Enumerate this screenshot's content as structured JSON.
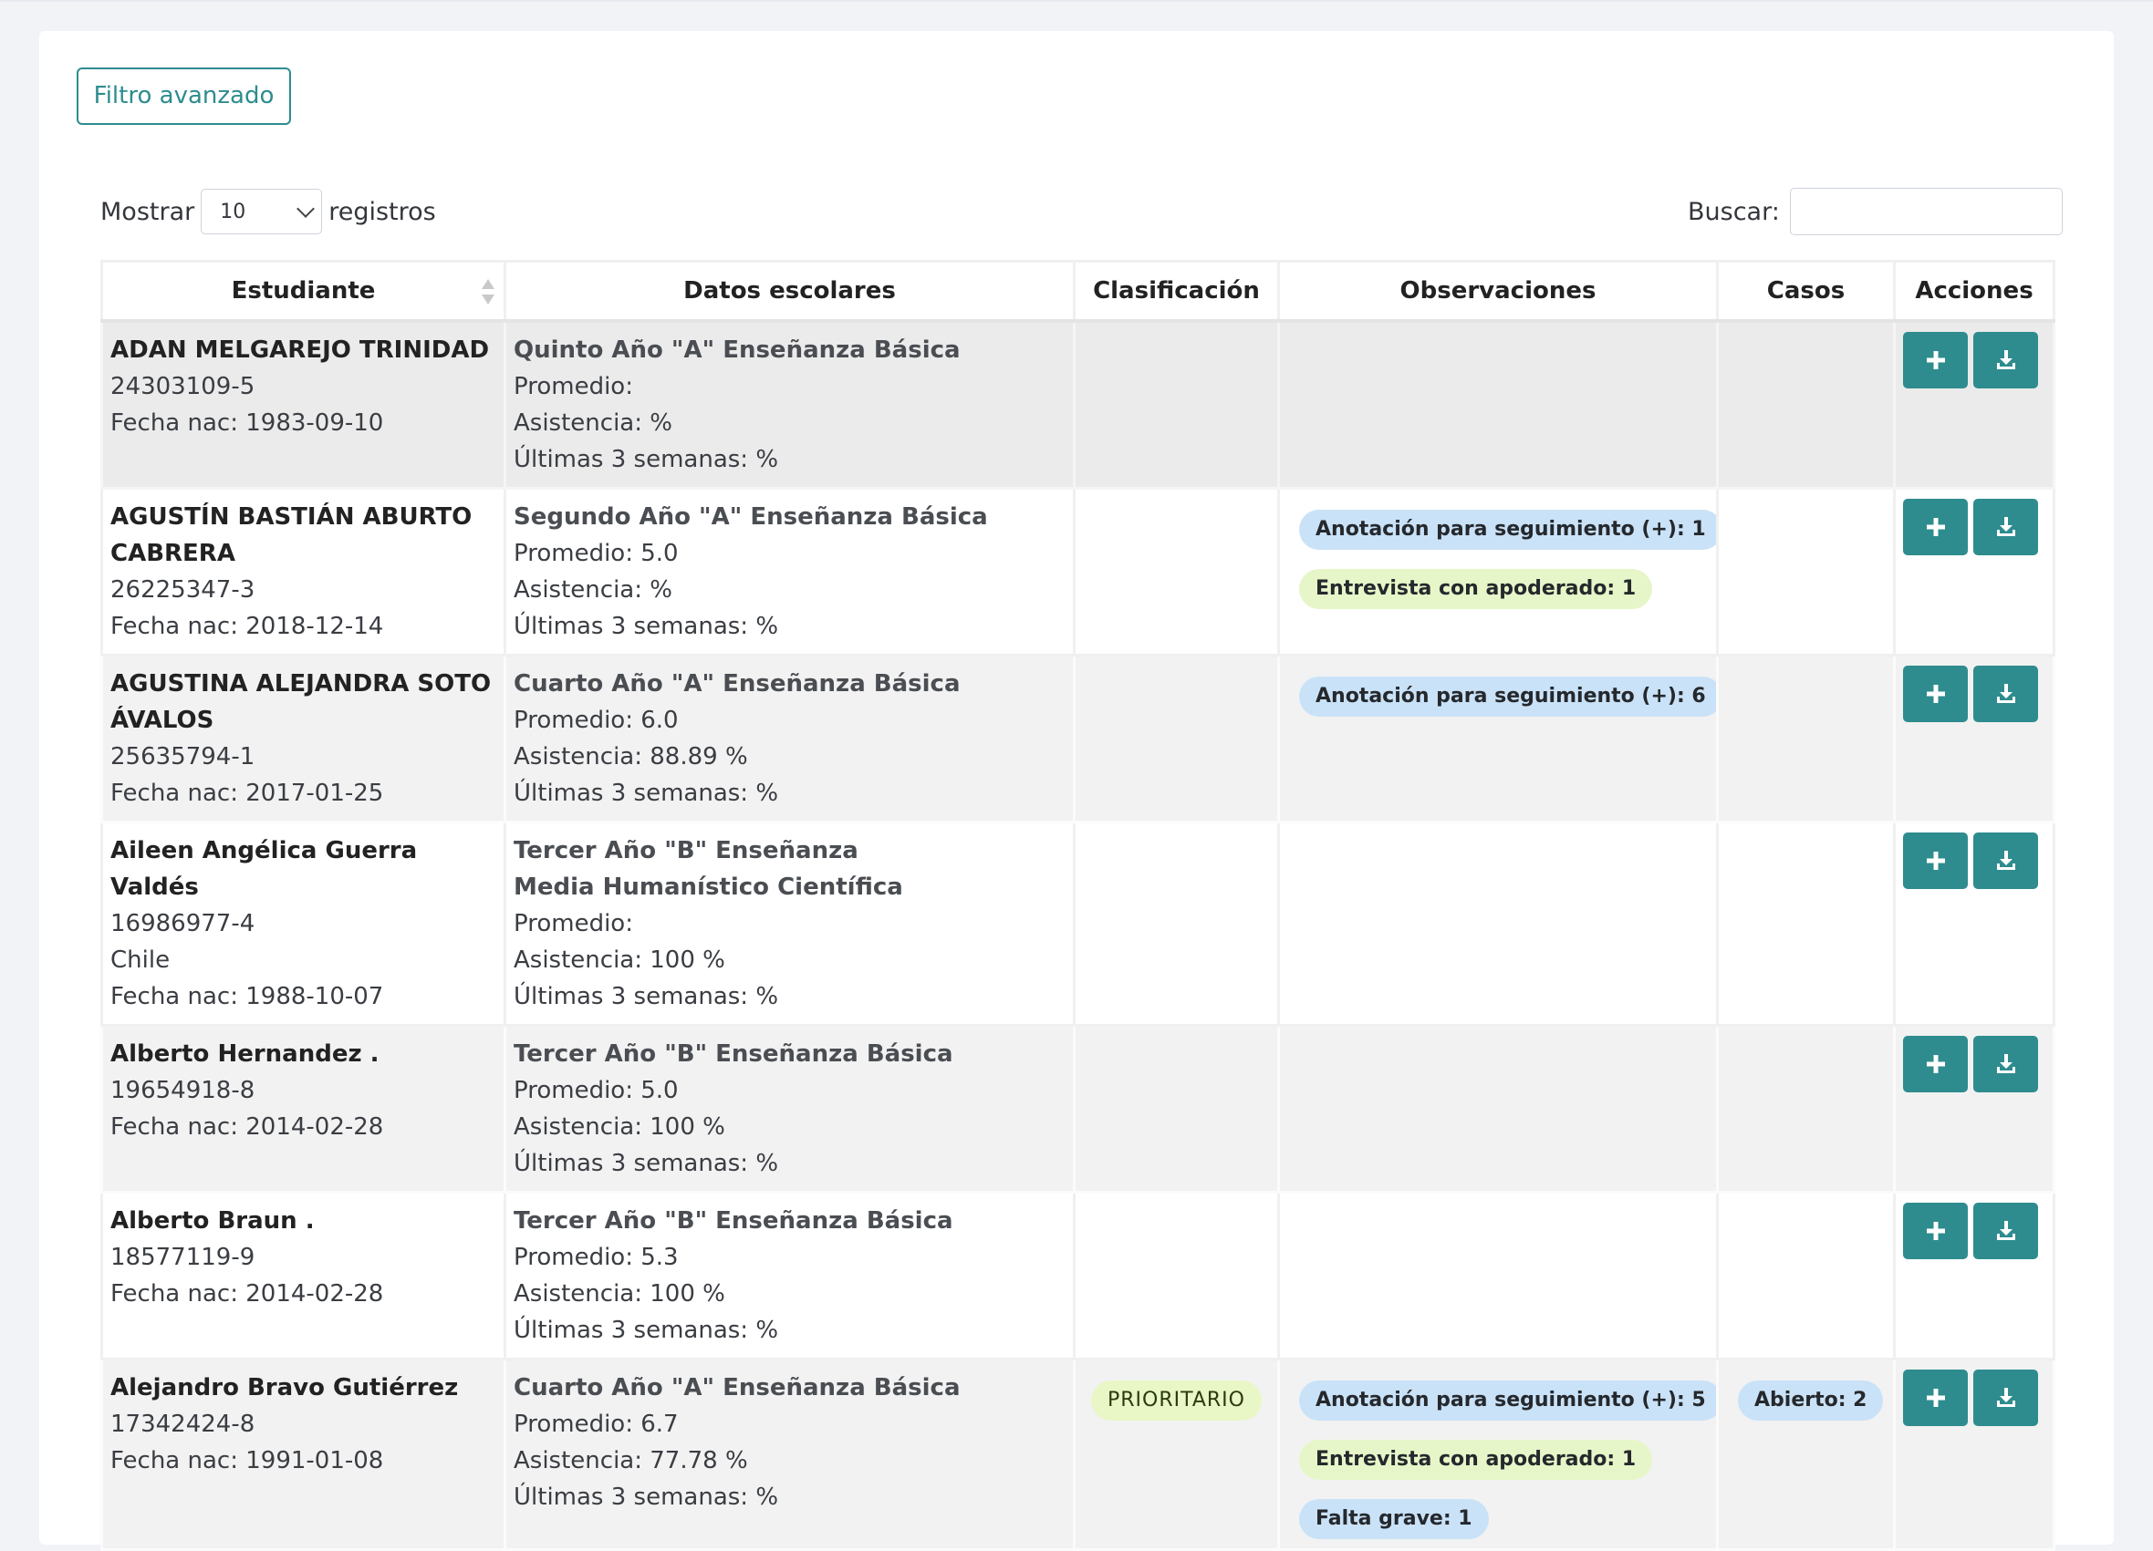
{
  "toolbar": {
    "filter_label": "Filtro avanzado"
  },
  "length": {
    "before": "Mostrar",
    "value": "10",
    "after": "registros"
  },
  "search": {
    "label": "Buscar:",
    "value": ""
  },
  "columns": [
    "Estudiante",
    "Datos escolares",
    "Clasificación",
    "Observaciones",
    "Casos",
    "Acciones"
  ],
  "rows": [
    {
      "name": "ADAN MELGAREJO TRINIDAD",
      "rut": "24303109-5",
      "birth": "Fecha nac: 1983-09-10",
      "course": "Quinto Año \"A\" Enseñanza Básica",
      "avg": "Promedio:",
      "att": "Asistencia: %",
      "last": "Últimas 3 semanas: %"
    },
    {
      "name": "AGUSTÍN BASTIÁN ABURTO CABRERA",
      "rut": "26225347-3",
      "birth": "Fecha nac: 2018-12-14",
      "course": "Segundo Año \"A\" Enseñanza Básica",
      "avg": "Promedio: 5.0",
      "att": "Asistencia: %",
      "last": "Últimas 3 semanas: %",
      "obs": [
        "Anotación para seguimiento (+): 1",
        "Entrevista con apoderado: 1"
      ]
    },
    {
      "name": "AGUSTINA ALEJANDRA SOTO ÁVALOS",
      "rut": "25635794-1",
      "birth": "Fecha nac: 2017-01-25",
      "course": "Cuarto Año \"A\" Enseñanza Básica",
      "avg": "Promedio: 6.0",
      "att": "Asistencia: 88.89 %",
      "last": "Últimas 3 semanas: %",
      "obs": [
        "Anotación para seguimiento (+): 6"
      ]
    },
    {
      "name": "Aileen Angélica Guerra Valdés",
      "rut": "16986977-4",
      "country": "Chile",
      "birth": "Fecha nac: 1988-10-07",
      "course": "Tercer Año \"B\" Enseñanza Media Humanístico Científica",
      "avg": "Promedio:",
      "att": "Asistencia: 100 %",
      "last": "Últimas 3 semanas: %"
    },
    {
      "name": "Alberto Hernandez .",
      "rut": "19654918-8",
      "birth": "Fecha nac: 2014-02-28",
      "course": "Tercer Año \"B\" Enseñanza Básica",
      "avg": "Promedio: 5.0",
      "att": "Asistencia: 100 %",
      "last": "Últimas 3 semanas: %"
    },
    {
      "name": "Alberto Braun .",
      "rut": "18577119-9",
      "birth": "Fecha nac: 2014-02-28",
      "course": "Tercer Año \"B\" Enseñanza Básica",
      "avg": "Promedio: 5.3",
      "att": "Asistencia: 100 %",
      "last": "Últimas 3 semanas: %"
    },
    {
      "name": "Alejandro Bravo Gutiérrez",
      "rut": "17342424-8",
      "birth": "Fecha nac: 1991-01-08",
      "course": "Cuarto Año \"A\" Enseñanza Básica",
      "avg": "Promedio: 6.7",
      "att": "Asistencia: 77.78 %",
      "last": "Últimas 3 semanas: %",
      "classification": "PRIORITARIO",
      "obs": [
        "Anotación para seguimiento (+): 5",
        "Entrevista con apoderado: 1",
        "Falta grave: 1"
      ],
      "cases": "Abierto: 2"
    }
  ],
  "icons": {
    "add": "plus-icon",
    "download": "download-icon"
  },
  "colors": {
    "accent": "#2e8c8e",
    "badge_blue": "#c9e2f8",
    "badge_green": "#e6f6c8"
  }
}
